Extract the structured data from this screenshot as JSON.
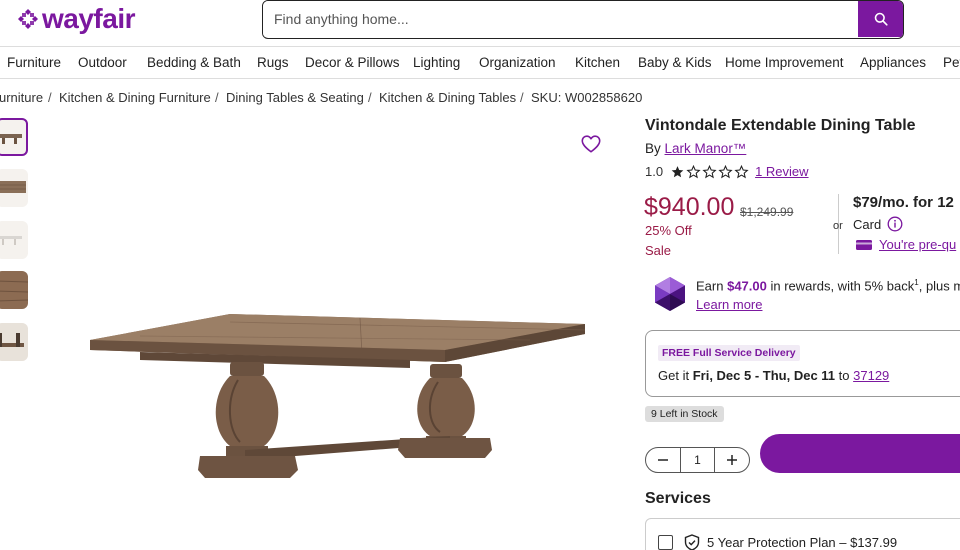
{
  "header": {
    "logo_text": "wayfair",
    "brand_color": "#7b189f",
    "search": {
      "placeholder": "Find anything home..."
    }
  },
  "nav": {
    "items": [
      "Furniture",
      "Outdoor",
      "Bedding & Bath",
      "Rugs",
      "Decor & Pillows",
      "Lighting",
      "Organization",
      "Kitchen",
      "Baby & Kids",
      "Home Improvement",
      "Appliances",
      "Pet"
    ]
  },
  "breadcrumb": {
    "items": [
      "urniture",
      "Kitchen & Dining Furniture",
      "Dining Tables & Seating",
      "Kitchen & Dining Tables",
      "SKU: W002858620"
    ],
    "separator": "/"
  },
  "product": {
    "title": "Vintondale Extendable Dining Table",
    "by_prefix": "By",
    "brand": "Lark Manor™",
    "rating_value": "1.0",
    "rating_stars": 1,
    "rating_max": 5,
    "reviews_label": "1 Review",
    "price": "$940.00",
    "original_price": "$1,249.99",
    "discount": "25% Off",
    "sale_label": "Sale",
    "price_color": "#9a1b47",
    "or_label": "or",
    "monthly": "$79/mo. for 12",
    "card_label": "Card",
    "prequal_label": "You're pre-qu"
  },
  "rewards": {
    "prefix": "Earn",
    "amount": "$47.00",
    "suffix": "in rewards, with 5% back",
    "superscript": "1",
    "tail": ", plus m",
    "learn_more": "Learn more"
  },
  "delivery": {
    "badge": "FREE Full Service Delivery",
    "prefix": "Get it",
    "dates": "Fri, Dec 5 - Thu, Dec 11",
    "to_label": "to",
    "zip": "37129"
  },
  "stock": {
    "label": "9 Left in Stock"
  },
  "quantity": {
    "value": "1"
  },
  "services": {
    "heading": "Services",
    "plan_label": "5 Year Protection Plan – $137.99"
  }
}
